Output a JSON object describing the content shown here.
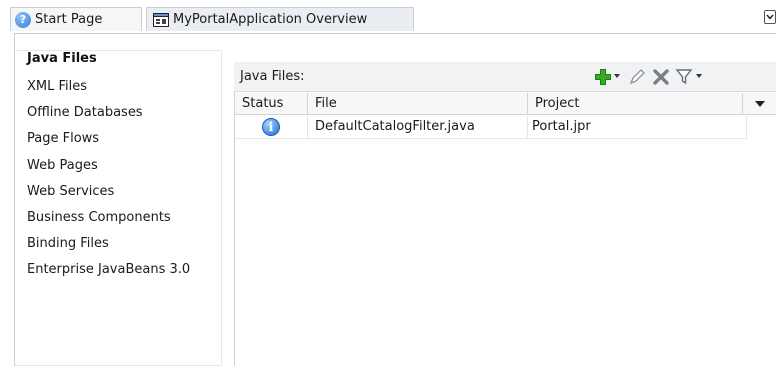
{
  "tabs": [
    {
      "label": "Start Page",
      "icon": "help-icon"
    },
    {
      "label": "MyPortalApplication Overview",
      "icon": "overview-icon"
    }
  ],
  "sidebar": {
    "header": "Java Files",
    "items": [
      "XML Files",
      "Offline Databases",
      "Page Flows",
      "Web Pages",
      "Web Services",
      "Business Components",
      "Binding Files",
      "Enterprise JavaBeans 3.0"
    ]
  },
  "table": {
    "title": "Java Files:",
    "toolbar_icons": [
      "add-icon",
      "dropdown-arrow-icon",
      "edit-icon",
      "delete-icon",
      "filter-icon",
      "dropdown-arrow-icon"
    ],
    "columns": [
      "Status",
      "File",
      "Project"
    ],
    "rows": [
      {
        "status_icon": "info-icon",
        "file": "DefaultCatalogFilter.java",
        "project": "Portal.jpr"
      }
    ]
  },
  "colors": {
    "add": "#3aa92a",
    "delete": "#7a7f86",
    "info": "#1f6fd1",
    "filter": "#6b7a90"
  }
}
